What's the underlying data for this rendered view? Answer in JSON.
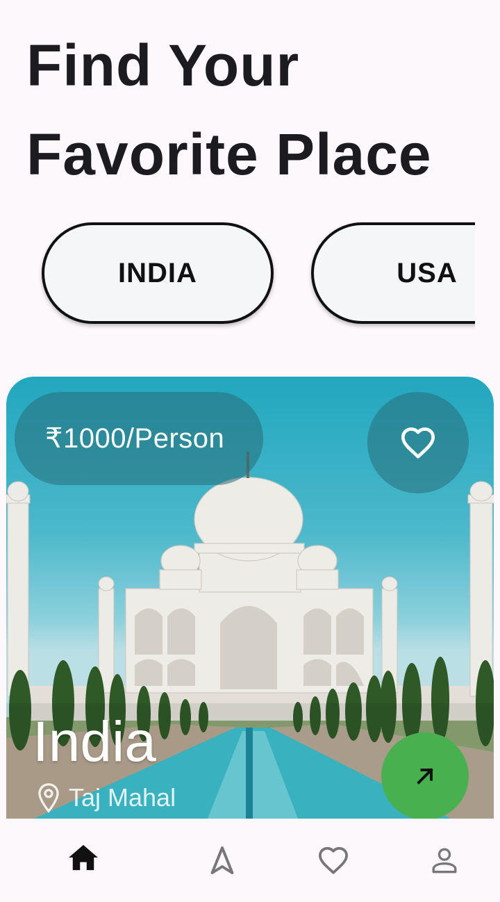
{
  "header": {
    "title_line1": "Find Your",
    "title_line2": "Favorite Place"
  },
  "countries": [
    {
      "label": "INDIA"
    },
    {
      "label": "USA"
    }
  ],
  "card": {
    "price": "₹1000/Person",
    "title": "India",
    "location": "Taj Mahal",
    "icons": {
      "favorite": "heart-outline-icon",
      "location": "location-pin-icon",
      "open": "arrow-up-right-icon"
    },
    "colors": {
      "sky": "#21a7bf",
      "action": "#49b04f"
    }
  },
  "bottom_nav": {
    "items": [
      {
        "icon": "home-icon",
        "active": true
      },
      {
        "icon": "navigation-icon",
        "active": false
      },
      {
        "icon": "heart-icon",
        "active": false
      },
      {
        "icon": "person-icon",
        "active": false
      }
    ]
  }
}
